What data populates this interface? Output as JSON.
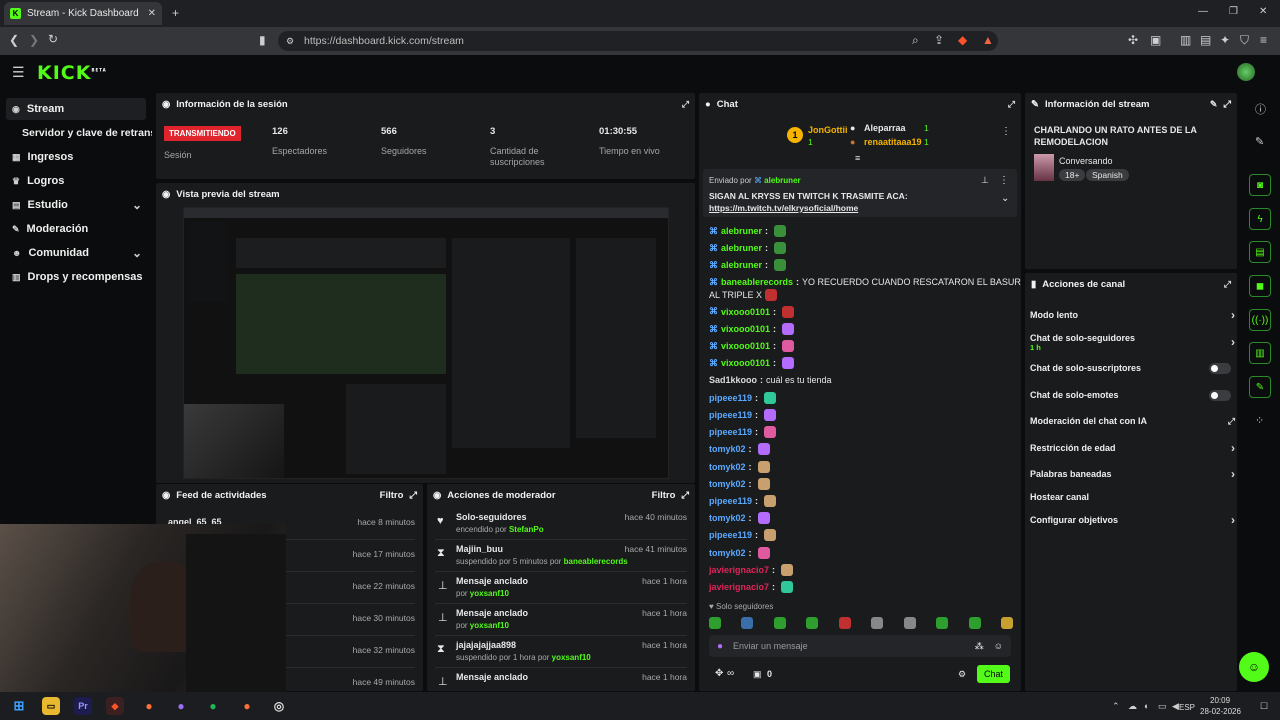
{
  "browser": {
    "tab_title": "Stream - Kick Dashboard",
    "url": "https://dashboard.kick.com/stream",
    "new_tab": "+"
  },
  "app": {
    "logo": "KICK",
    "logo_sup": "BETA"
  },
  "sidebar": {
    "items": [
      {
        "label": "Stream"
      },
      {
        "label": "Servidor y clave de retransm"
      },
      {
        "label": "Ingresos"
      },
      {
        "label": "Logros"
      },
      {
        "label": "Estudio"
      },
      {
        "label": "Moderación"
      },
      {
        "label": "Comunidad"
      },
      {
        "label": "Drops y recompensas"
      }
    ]
  },
  "session": {
    "title": "Información de la sesión",
    "status": "TRANSMITIENDO",
    "status_label": "Sesión",
    "viewers": "126",
    "viewers_label": "Espectadores",
    "followers": "566",
    "followers_label": "Seguidores",
    "subs": "3",
    "subs_label": "Cantidad de suscripciones",
    "time": "01:30:55",
    "time_label": "Tiempo en vivo"
  },
  "preview": {
    "title": "Vista previa del stream"
  },
  "feed": {
    "title": "Feed de actividades",
    "filter": "Filtro",
    "rows": [
      {
        "user": "angel_65_65",
        "time": "hace 8 minutos"
      },
      {
        "user": "",
        "time": "hace 17 minutos"
      },
      {
        "user": "",
        "time": "hace 22 minutos"
      },
      {
        "user": "",
        "time": "hace 30 minutos"
      },
      {
        "user": "",
        "time": "hace 32 minutos"
      },
      {
        "user": "",
        "time": "hace 49 minutos"
      }
    ]
  },
  "mod": {
    "title": "Acciones de moderador",
    "filter": "Filtro",
    "rows": [
      {
        "title": "Solo-seguidores",
        "sub": "encendido por ",
        "who": "StefanPo",
        "time": "hace 40 minutos"
      },
      {
        "title": "Majiin_buu",
        "sub": "suspendido por 5 minutos por ",
        "who": "baneablerecords",
        "time": "hace 41 minutos"
      },
      {
        "title": "Mensaje anclado",
        "sub": "por ",
        "who": "yoxsanf10",
        "time": "hace 1 hora"
      },
      {
        "title": "Mensaje anclado",
        "sub": "por ",
        "who": "yoxsanf10",
        "time": "hace 1 hora"
      },
      {
        "title": "jajajajajjaa898",
        "sub": "suspendido por 1 hora por ",
        "who": "yoxsanf10",
        "time": "hace 1 hora"
      },
      {
        "title": "Mensaje anclado",
        "sub": "",
        "who": "",
        "time": "hace 1 hora"
      }
    ]
  },
  "chat": {
    "title": "Chat",
    "top": [
      {
        "rank": "1",
        "name": "JonGottii",
        "count": "1"
      },
      {
        "name": "Aleparraa",
        "count": "1"
      },
      {
        "name": "renaatitaaa19",
        "count": "1"
      }
    ],
    "pinned_by": "Enviado por",
    "pinned_user": "alebruner",
    "pinned_text": "SIGAN AL KRYSS EN TWITCH K TRASMITE ACA:",
    "pinned_link": "https://m.twitch.tv/elkrysoficial/home",
    "messages": [
      {
        "user": "alebruner",
        "text": "",
        "color": "#53fc18",
        "mod": true
      },
      {
        "user": "alebruner",
        "text": "",
        "color": "#53fc18",
        "mod": true
      },
      {
        "user": "alebruner",
        "text": "",
        "color": "#53fc18",
        "mod": true
      },
      {
        "user": "baneablerecords",
        "text": " YO RECUERDO CUANDO RESCATARON EL BASURERO",
        "color": "#53fc18",
        "mod": true
      },
      {
        "user": "",
        "text": "AL TRIPLE X",
        "color": "#eee",
        "mod": false
      },
      {
        "user": "vixooo0101",
        "text": "",
        "color": "#53fc18",
        "mod": true
      },
      {
        "user": "vixooo0101",
        "text": "",
        "color": "#53fc18",
        "mod": true
      },
      {
        "user": "vixooo0101",
        "text": "",
        "color": "#53fc18",
        "mod": true
      },
      {
        "user": "vixooo0101",
        "text": "",
        "color": "#53fc18",
        "mod": true
      },
      {
        "user": "Sad1kkooo",
        "text": " cuál es tu tienda",
        "color": "#dcdcdc",
        "mod": false
      },
      {
        "user": "pipeee119",
        "text": "",
        "color": "#5aa9ff",
        "mod": false
      },
      {
        "user": "pipeee119",
        "text": "",
        "color": "#5aa9ff",
        "mod": false
      },
      {
        "user": "pipeee119",
        "text": "",
        "color": "#5aa9ff",
        "mod": false
      },
      {
        "user": "tomyk02",
        "text": "",
        "color": "#5aa9ff",
        "mod": false
      },
      {
        "user": "tomyk02",
        "text": "",
        "color": "#5aa9ff",
        "mod": false
      },
      {
        "user": "tomyk02",
        "text": "",
        "color": "#5aa9ff",
        "mod": false
      },
      {
        "user": "pipeee119",
        "text": "",
        "color": "#5aa9ff",
        "mod": false
      },
      {
        "user": "tomyk02",
        "text": "",
        "color": "#5aa9ff",
        "mod": false
      },
      {
        "user": "pipeee119",
        "text": "",
        "color": "#5aa9ff",
        "mod": false
      },
      {
        "user": "tomyk02",
        "text": "",
        "color": "#5aa9ff",
        "mod": false
      },
      {
        "user": "javierignacio7",
        "text": "",
        "color": "#e0245a",
        "mod": false
      },
      {
        "user": "javierignacio7",
        "text": "",
        "color": "#e0245a",
        "mod": false
      }
    ],
    "mode": "Solo seguidores",
    "placeholder": "Enviar un mensaje",
    "count": "0",
    "send": "Chat",
    "infinity": "∞"
  },
  "info": {
    "title": "Información del stream",
    "stream_title": "CHARLANDO UN RATO ANTES DE LA REMODELACION",
    "category": "Conversando",
    "tags": [
      "18+",
      "Spanish"
    ]
  },
  "actions": {
    "title": "Acciones de canal",
    "items": [
      {
        "label": "Modo lento",
        "kind": "chevron"
      },
      {
        "label": "Chat de solo-seguidores",
        "sub": "1 h",
        "kind": "chevron"
      },
      {
        "label": "Chat de solo-suscriptores",
        "kind": "toggle"
      },
      {
        "label": "Chat de solo-emotes",
        "kind": "toggle"
      },
      {
        "label": "Moderación del chat con IA",
        "kind": "external"
      },
      {
        "label": "Restricción de edad",
        "kind": "chevron"
      },
      {
        "label": "Palabras baneadas",
        "kind": "chevron"
      },
      {
        "label": "Hostear canal",
        "kind": "none"
      },
      {
        "label": "Configurar objetivos",
        "kind": "chevron"
      }
    ]
  },
  "taskbar": {
    "time": "20:09",
    "date": "28-02-2026",
    "lang": "ESP"
  },
  "colors": {
    "accent": "#53fc18",
    "live": "#e0242e",
    "link": "#5aa9ff"
  }
}
